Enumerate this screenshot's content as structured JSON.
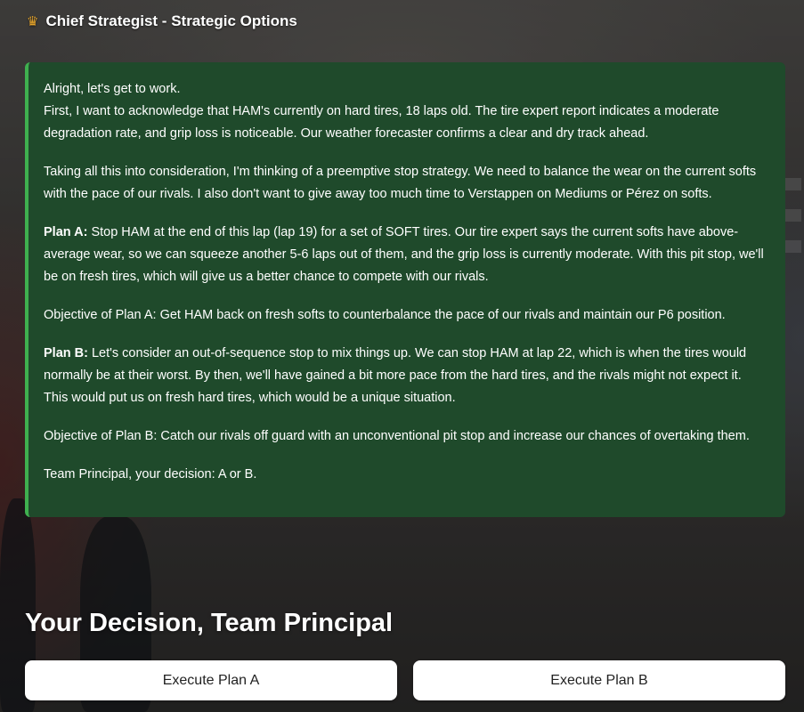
{
  "header": {
    "icon": "crown-icon",
    "title": "Chief Strategist - Strategic Options"
  },
  "message": {
    "intro_line1": "Alright, let's get to work.",
    "intro_line2": "First, I want to acknowledge that HAM's currently on hard tires, 18 laps old. The tire expert report indicates a moderate degradation rate, and grip loss is noticeable. Our weather forecaster confirms a clear and dry track ahead.",
    "consideration": "Taking all this into consideration, I'm thinking of a preemptive stop strategy. We need to balance the wear on the current softs with the pace of our rivals. I also don't want to give away too much time to Verstappen on Mediums or Pérez on softs.",
    "plan_a_label": "Plan A:",
    "plan_a_text": " Stop HAM at the end of this lap (lap 19) for a set of SOFT tires. Our tire expert says the current softs have above-average wear, so we can squeeze another 5-6 laps out of them, and the grip loss is currently moderate. With this pit stop, we'll be on fresh tires, which will give us a better chance to compete with our rivals.",
    "objective_a": "Objective of Plan A: Get HAM back on fresh softs to counterbalance the pace of our rivals and maintain our P6 position.",
    "plan_b_label": "Plan B:",
    "plan_b_text": " Let's consider an out-of-sequence stop to mix things up. We can stop HAM at lap 22, which is when the tires would normally be at their worst. By then, we'll have gained a bit more pace from the hard tires, and the rivals might not expect it. This would put us on fresh hard tires, which would be a unique situation.",
    "objective_b": "Objective of Plan B: Catch our rivals off guard with an unconventional pit stop and increase our chances of overtaking them.",
    "closing": "Team Principal, your decision: A or B."
  },
  "decision": {
    "title": "Your Decision, Team Principal",
    "button_a": "Execute Plan A",
    "button_b": "Execute Plan B"
  },
  "colors": {
    "panel_bg": "#1f4a2b",
    "panel_accent": "#3fb04f",
    "button_bg": "#ffffff"
  }
}
